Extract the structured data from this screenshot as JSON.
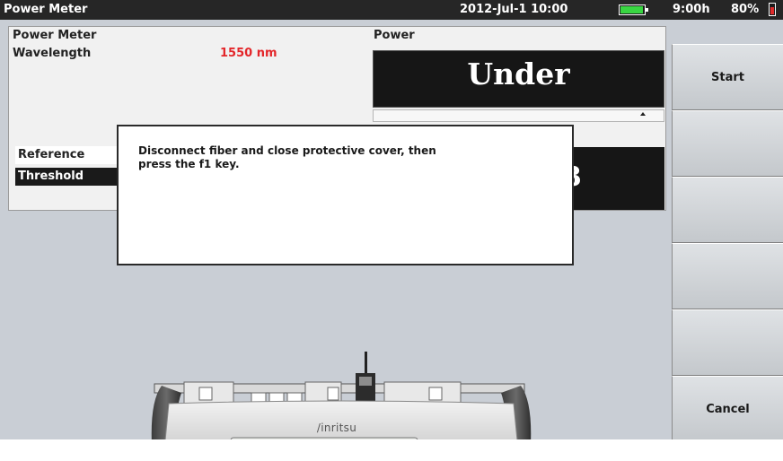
{
  "header": {
    "title": "Power Meter",
    "datetime": "2012-Jul-1 10:00",
    "battery_time": "9:00h",
    "battery_percent": "80%"
  },
  "panel": {
    "section_label": "Power Meter",
    "wavelength_label": "Wavelength",
    "wavelength_value": "1550 nm",
    "power_label": "Power",
    "power_value": "Under",
    "second_box_partial": "3",
    "reference_label": "Reference",
    "threshold_label": "Threshold"
  },
  "dialog": {
    "message_line1": "Disconnect fiber and close protective cover, then",
    "message_line2": "press the f1 key."
  },
  "device": {
    "brand": "/inritsu"
  },
  "softkeys": [
    "Start",
    "",
    "",
    "",
    "",
    "Cancel"
  ],
  "colors": {
    "titlebar": "#262626",
    "main_bg": "#c9ced5",
    "wavelength_value": "#e3262a",
    "power_box": "#161616",
    "battery_fill": "#39d642"
  }
}
